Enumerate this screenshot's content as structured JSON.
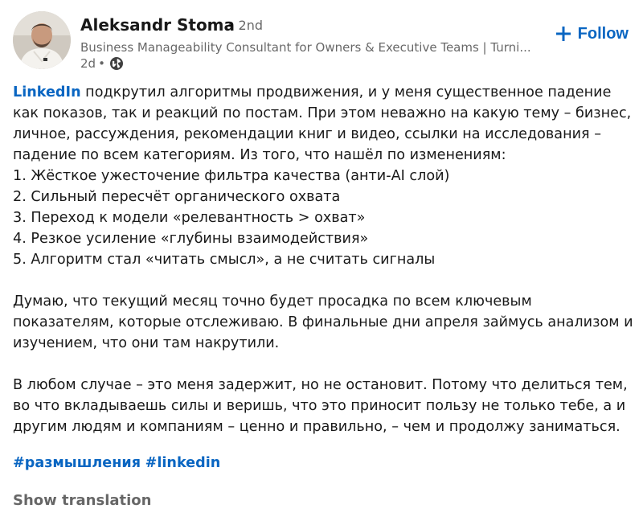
{
  "author": {
    "name": "Aleksandr Stoma",
    "degree": "• 2nd",
    "headline": "Business Manageability Consultant for Owners & Executive Teams | Turni...",
    "time": "2d",
    "meta_separator": "•",
    "visibility_icon": "globe-icon",
    "avatar_icon": "profile-photo"
  },
  "follow_button": {
    "label": "Follow",
    "icon": "plus-icon"
  },
  "colors": {
    "link": "#0a66c2",
    "text": "#1f1f1f",
    "secondary": "#666666"
  },
  "post": {
    "mention": "LinkedIn",
    "intro_rest": " подкрутил алгоритмы продвижения, и у меня существенное падение как показов, так и реакций по постам. При этом неважно на какую тему – бизнес, личное, рассуждения, рекомендации книг и видео, ссылки на исследования – падение по всем категориям. Из того, что нашёл по изменениям:",
    "list": [
      "1. Жёсткое ужесточение фильтра качества (анти-AI слой)",
      "2. Сильный пересчёт органического охвата",
      "3. Переход к модели «релевантность > охват»",
      "4. Резкое усиление «глубины взаимодействия»",
      "5. Алгоритм стал «читать смысл», а не считать сигналы"
    ],
    "paragraph2": "Думаю, что текущий месяц точно будет просадка по всем ключевым показателям, которые отслеживаю. В финальные дни апреля займусь анализом и изучением, что они там накрутили.",
    "paragraph3": "В любом случае – это меня задержит, но не остановит. Потому что делиться тем, во что вкладываешь силы и веришь, что это приносит пользу не только тебе, а и другим людям и компаниям – ценно и правильно, – чем и продолжу заниматься.",
    "hashtags": [
      "#размышления",
      "#linkedin"
    ]
  },
  "show_translation_label": "Show translation"
}
